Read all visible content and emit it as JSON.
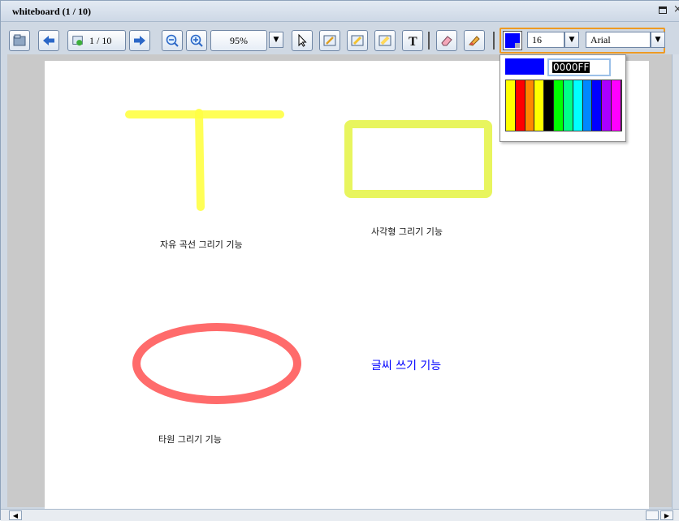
{
  "window": {
    "title": "whiteboard (1 / 10)"
  },
  "toolbar": {
    "page_indicator": "1 / 10",
    "zoom_value": "95%",
    "font_size": "16",
    "font_family": "Arial"
  },
  "color_picker": {
    "current_color": "#0000FF",
    "hex_value": "0000FF",
    "palette": [
      "#ffff00",
      "#ff0000",
      "#ff8800",
      "#ffff00",
      "#000000",
      "#00ff00",
      "#00ff88",
      "#00ffff",
      "#0088ff",
      "#0000ff",
      "#aa00ff",
      "#ff00ff"
    ]
  },
  "canvas": {
    "label_freehand": "자유 곡선 그리기 기능",
    "label_rectangle": "사각형 그리기 기능",
    "label_ellipse": "타원 그리기 기능",
    "text_sample": "글씨 쓰기 기능",
    "colors": {
      "freehand": "#ffff44",
      "rectangle": "#e8f55e",
      "ellipse": "#ff6b6b",
      "text": "#0000ff"
    }
  }
}
